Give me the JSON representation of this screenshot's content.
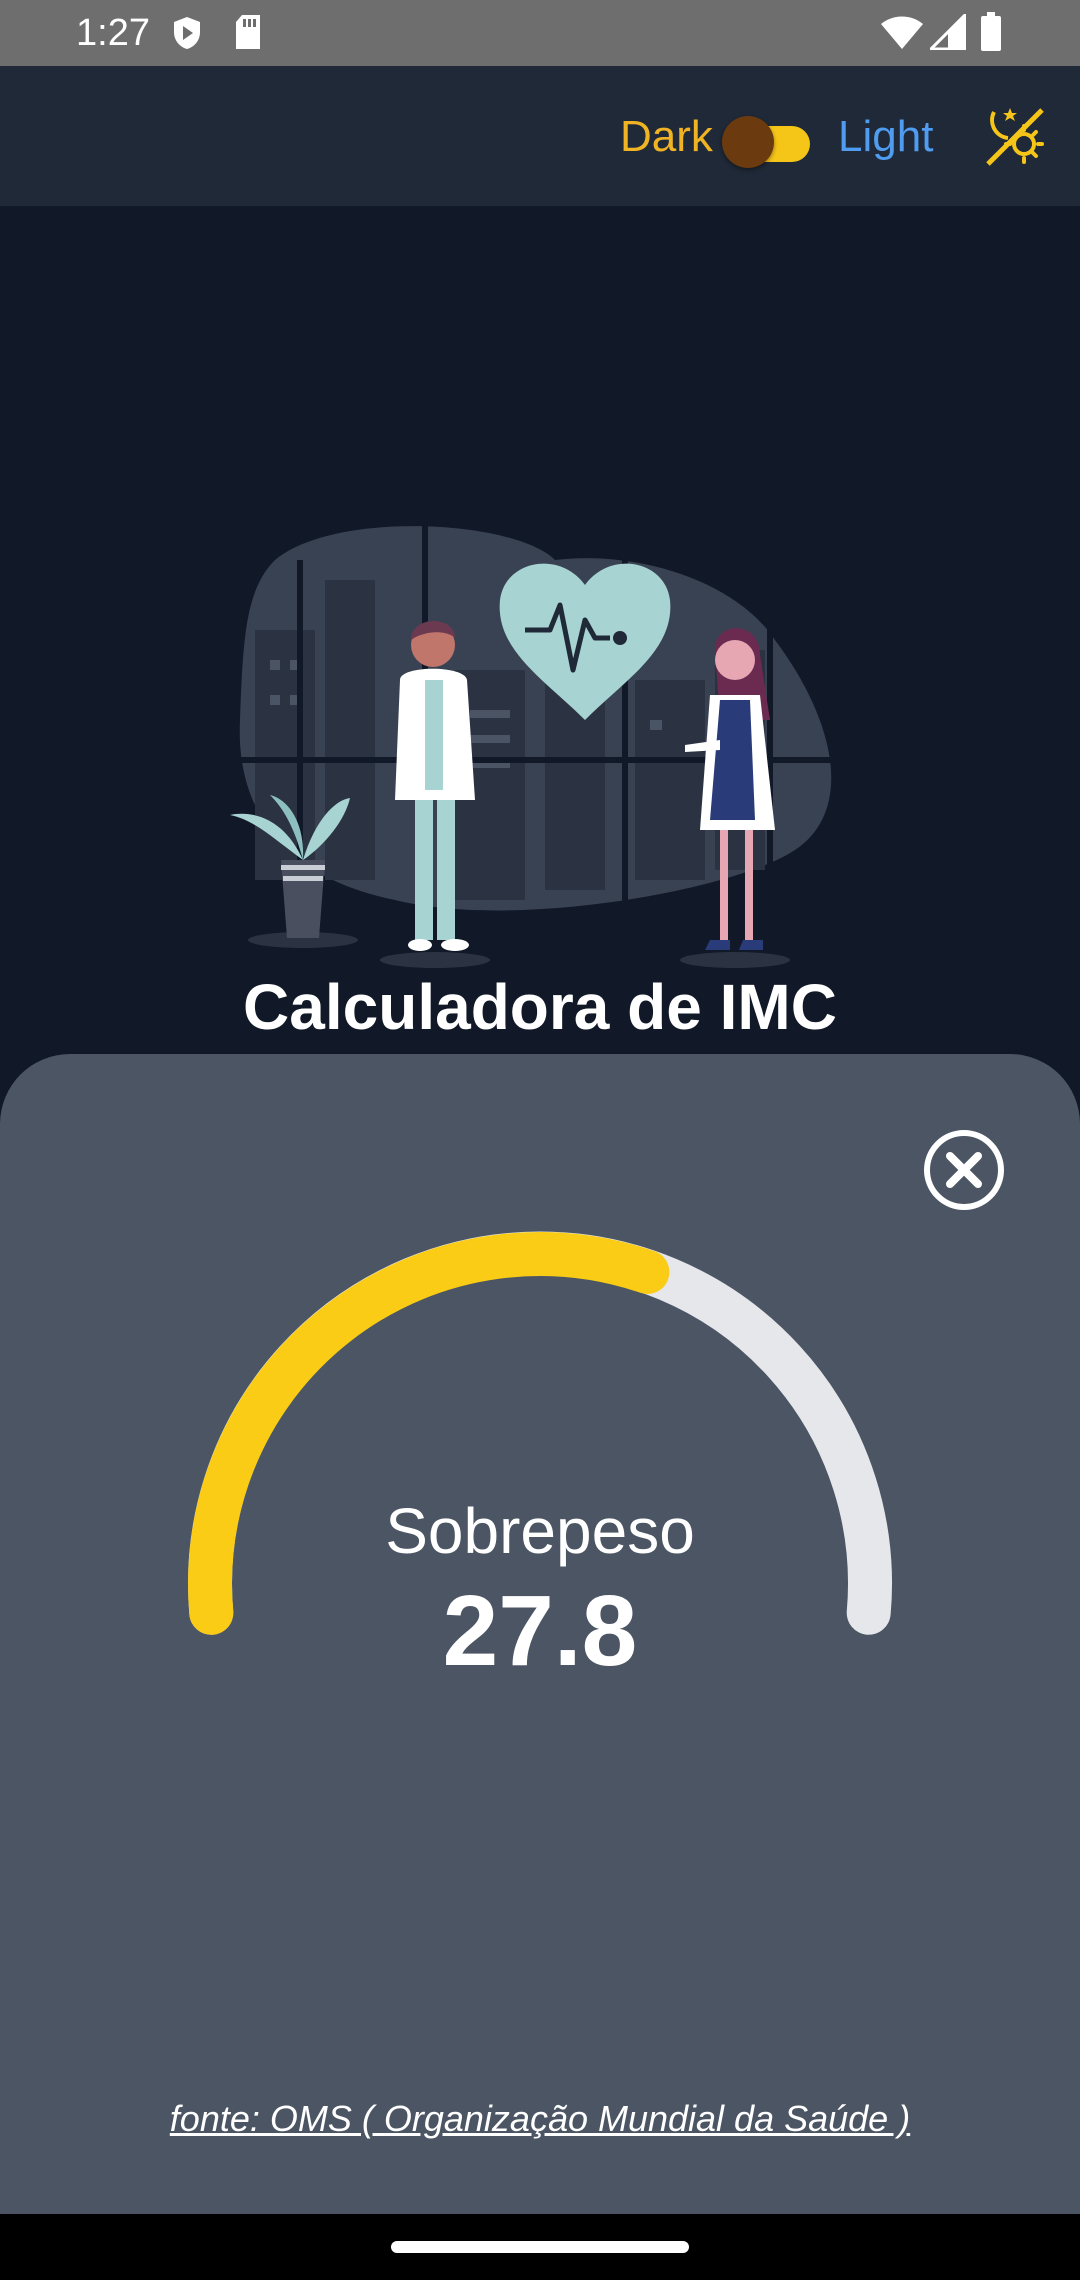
{
  "status_bar": {
    "time": "1:27",
    "icons": [
      "shield-play-icon",
      "sd-card-icon",
      "wifi-icon",
      "signal-icon",
      "battery-icon"
    ]
  },
  "app_bar": {
    "dark_label": "Dark",
    "light_label": "Light",
    "theme_toggle_on": true,
    "theme_icon": "sun-moon-icon"
  },
  "hero": {
    "title": "Calculadora de IMC"
  },
  "result": {
    "category": "Sobrepeso",
    "bmi": "27.8",
    "gauge_fraction": 0.6,
    "source": "fonte: OMS ( Organização Mundial da Saúde )"
  },
  "colors": {
    "background": "#111827",
    "app_bar": "#1f2937",
    "sheet": "#4b5563",
    "accent_yellow": "#facc15",
    "gauge_track": "#e5e7eb",
    "light_blue": "#4f9cf0"
  }
}
